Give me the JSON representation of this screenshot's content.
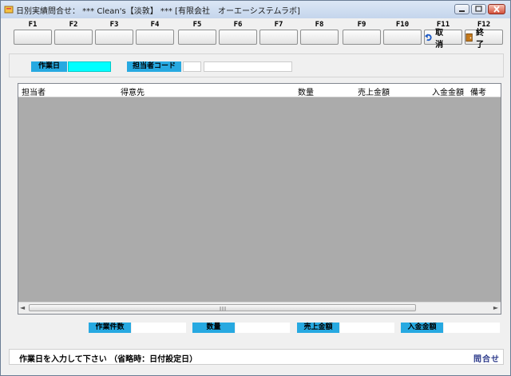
{
  "window": {
    "title": "日別実績問合せ： *** Clean's【淡敦】 *** [有限会社　オーエーシステムラボ]"
  },
  "fkeys": [
    {
      "key": "F1",
      "label": ""
    },
    {
      "key": "F2",
      "label": ""
    },
    {
      "key": "F3",
      "label": ""
    },
    {
      "key": "F4",
      "label": ""
    },
    {
      "key": "F5",
      "label": ""
    },
    {
      "key": "F6",
      "label": ""
    },
    {
      "key": "F7",
      "label": ""
    },
    {
      "key": "F8",
      "label": ""
    },
    {
      "key": "F9",
      "label": ""
    },
    {
      "key": "F10",
      "label": ""
    },
    {
      "key": "F11",
      "label": "取 消",
      "icon": "undo-icon"
    },
    {
      "key": "F12",
      "label": "終 了",
      "icon": "exit-door-icon"
    }
  ],
  "form": {
    "work_date_label": "作業日",
    "work_date_value": "",
    "staff_code_label": "担当者コード",
    "staff_code_value": "",
    "staff_name_value": ""
  },
  "grid": {
    "columns": [
      "担当者",
      "得意先",
      "数量",
      "売上金額",
      "入金金額",
      "備考"
    ],
    "rows": []
  },
  "totals": {
    "count_label": "作業件数",
    "count_value": "",
    "qty_label": "数量",
    "qty_value": "",
    "sales_label": "売上金額",
    "sales_value": "",
    "payment_label": "入金金額",
    "payment_value": ""
  },
  "status": {
    "message": "作業日を入力して下さい （省略時：日付設定日）",
    "mode": "問合せ"
  },
  "colors": {
    "caption_bg": "#27a9e1",
    "grid_bg": "#ababab"
  }
}
